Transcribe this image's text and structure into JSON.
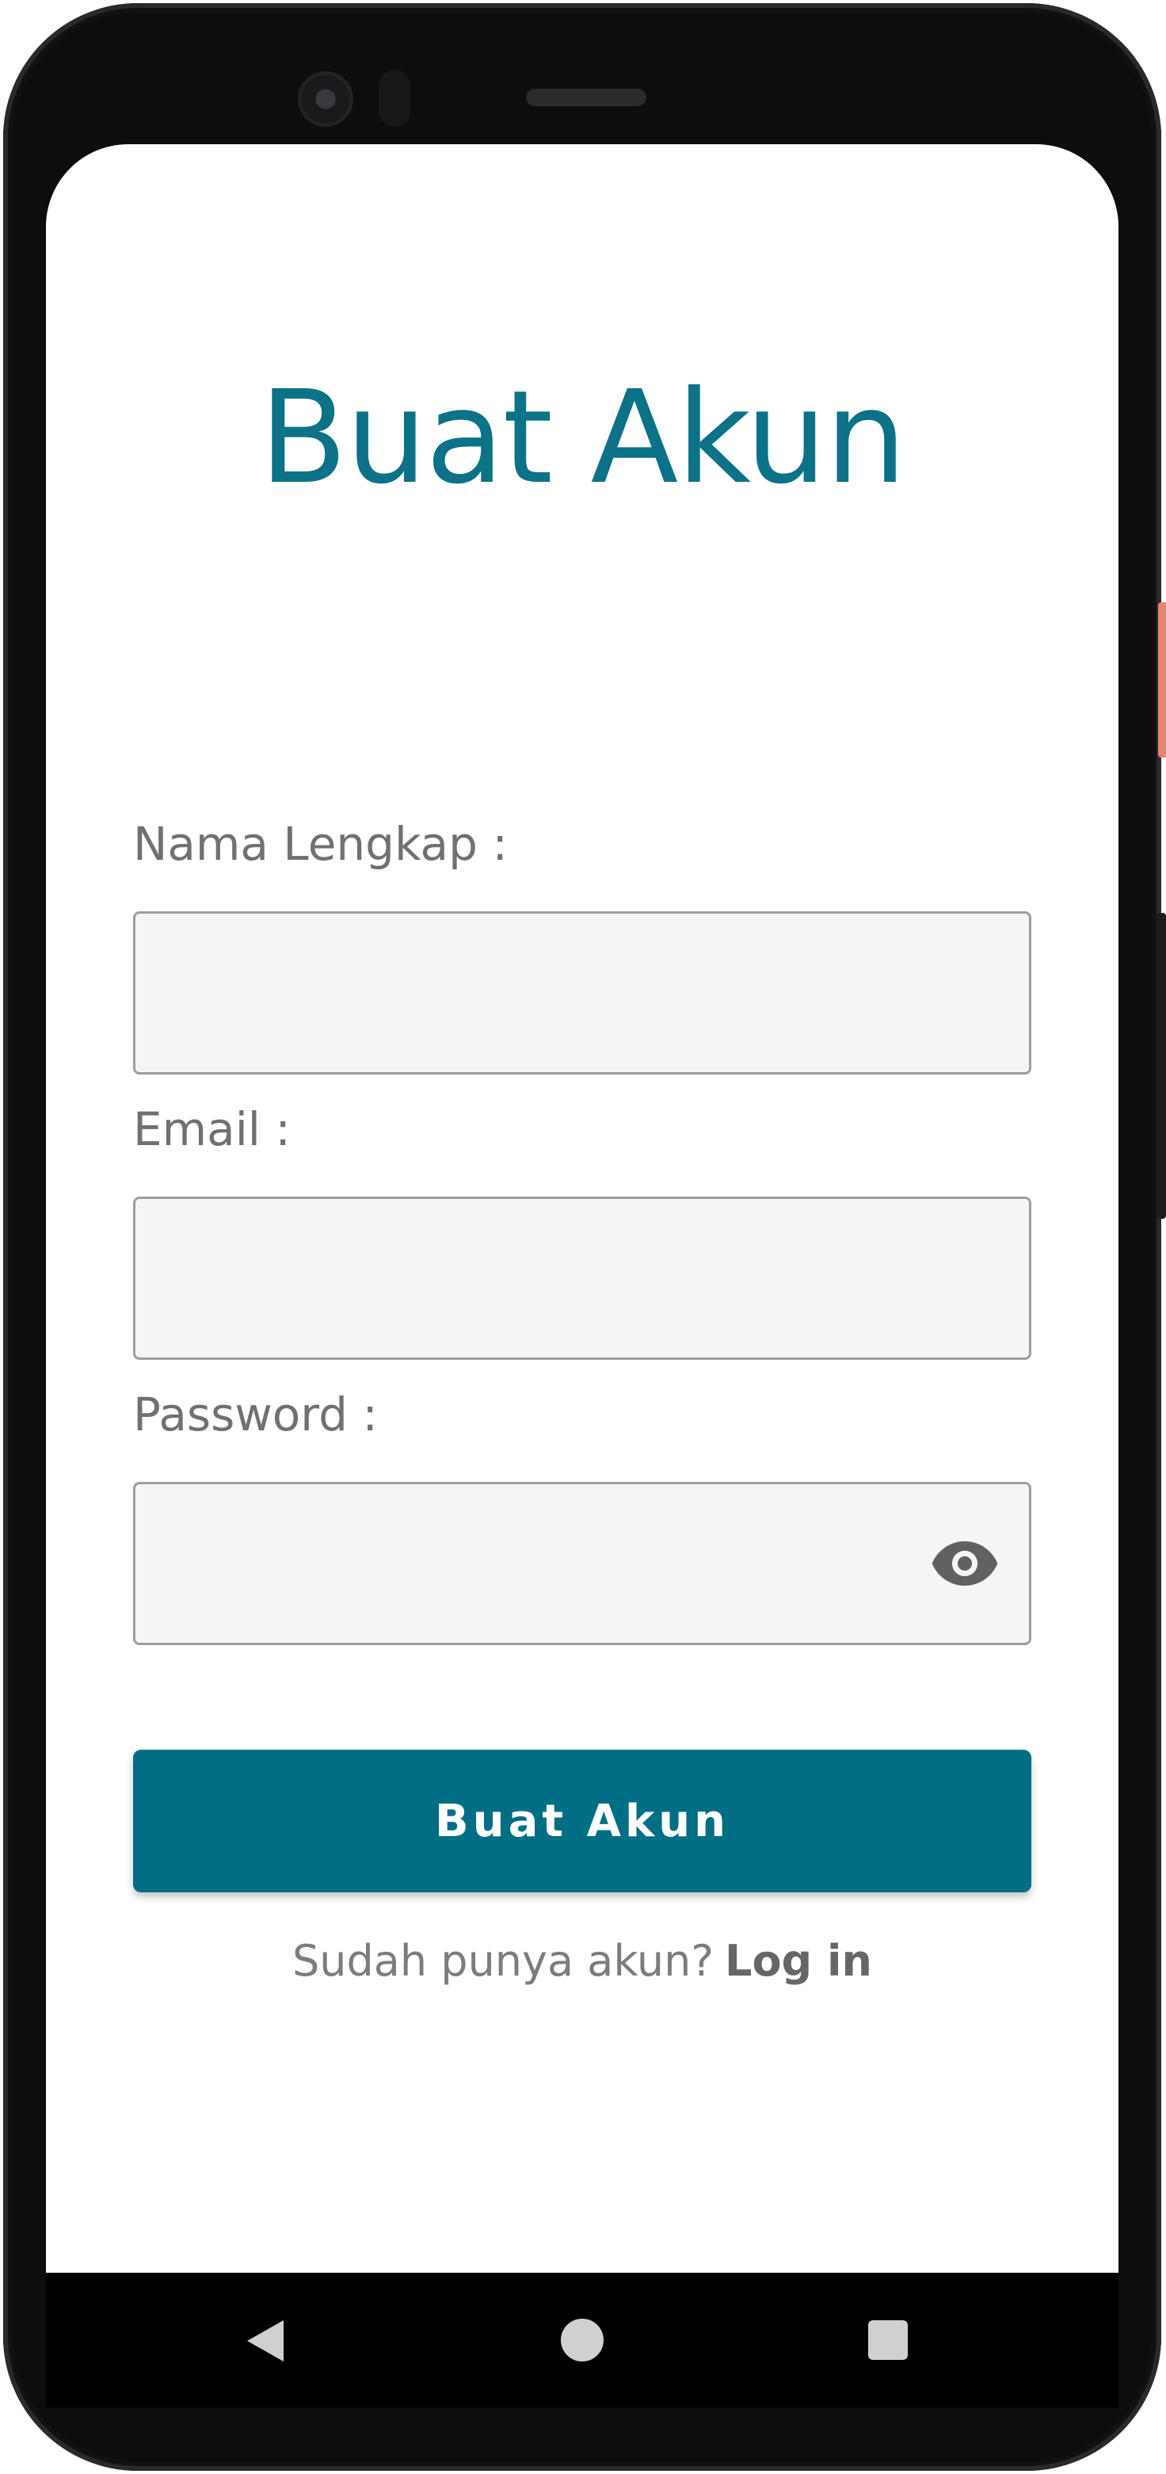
{
  "screen": {
    "title": "Buat Akun"
  },
  "form": {
    "name_label": "Nama Lengkap :",
    "name_value": "",
    "email_label": "Email :",
    "email_value": "",
    "password_label": "Password :",
    "password_value": "",
    "password_toggle_icon": "eye-icon"
  },
  "actions": {
    "submit_label": "Buat Akun",
    "login_prompt": "Sudah punya akun?",
    "login_link": "Log in"
  },
  "navbar": {
    "back_icon": "back-icon",
    "home_icon": "home-icon",
    "recent_icon": "recent-apps-icon"
  },
  "colors": {
    "accent": "#006e84",
    "title": "#0b7287",
    "field_bg": "#f5f5f5",
    "label": "#707070"
  }
}
